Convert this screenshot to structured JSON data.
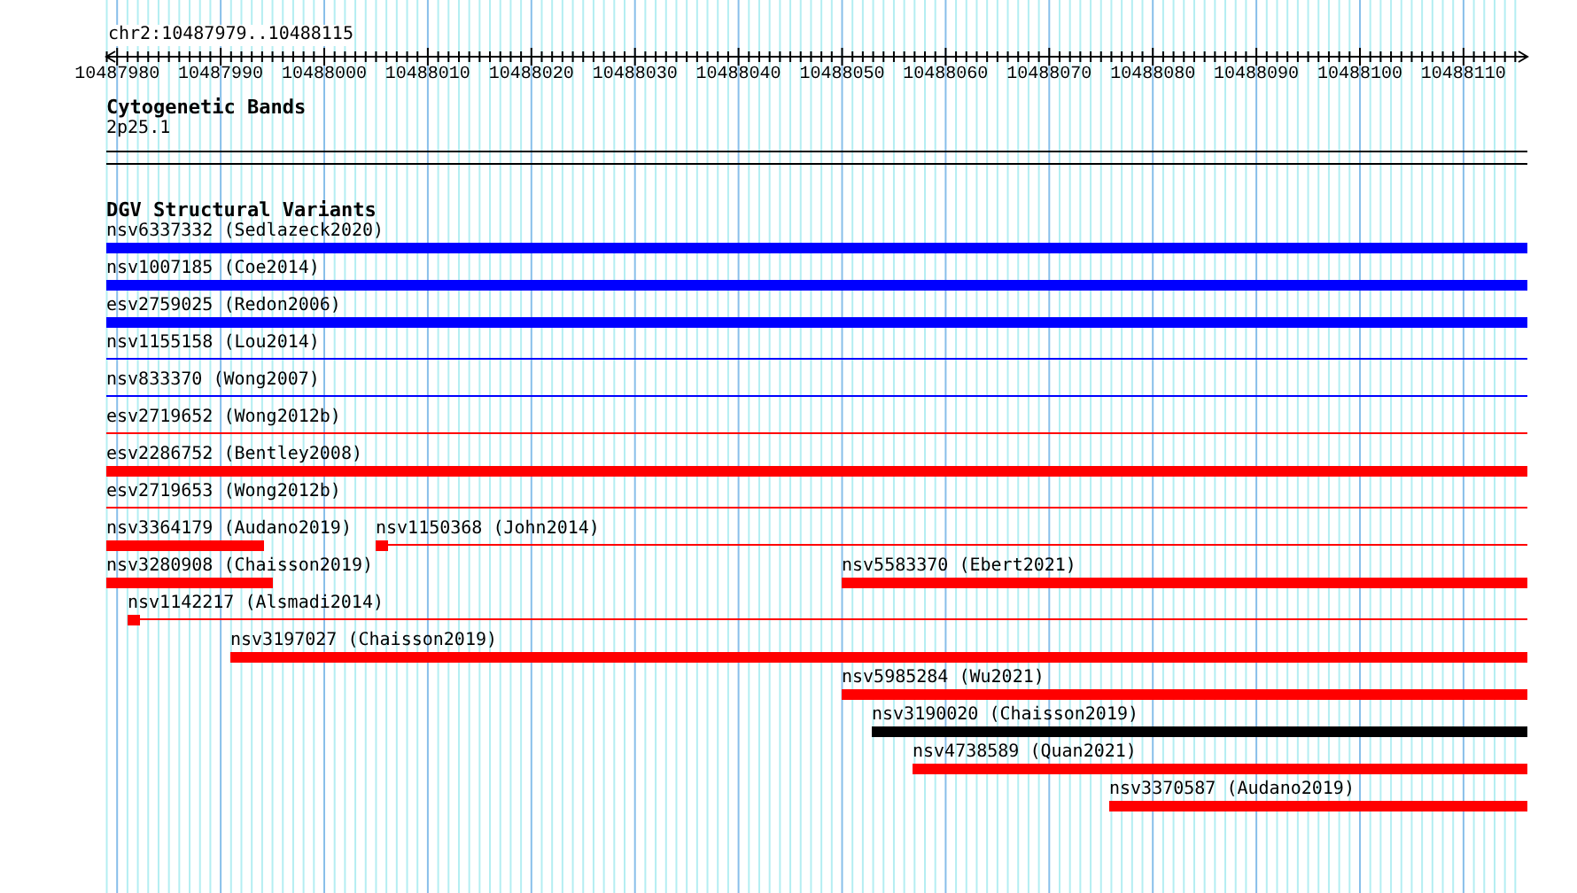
{
  "ruler": {
    "title": "chr2:10487979..10488115",
    "ticks": [
      "10487980",
      "10487990",
      "10488000",
      "10488010",
      "10488020",
      "10488030",
      "10488040",
      "10488050",
      "10488060",
      "10488070",
      "10488080",
      "10488090",
      "10488100",
      "10488110"
    ]
  },
  "cytoband_track": {
    "title": "Cytogenetic Bands",
    "band": "2p25.1"
  },
  "variant_track": {
    "title": "DGV Structural Variants",
    "rows": [
      {
        "features": [
          {
            "label": "nsv6337332 (Sedlazeck2020)",
            "kind": "bar",
            "color": "#0000ff"
          }
        ]
      },
      {
        "features": [
          {
            "label": "nsv1007185 (Coe2014)",
            "kind": "bar",
            "color": "#0000ff"
          }
        ]
      },
      {
        "features": [
          {
            "label": "esv2759025 (Redon2006)",
            "kind": "bar",
            "color": "#0000ff"
          }
        ]
      },
      {
        "features": [
          {
            "label": "nsv1155158 (Lou2014)",
            "kind": "line",
            "color": "#0000ff"
          }
        ]
      },
      {
        "features": [
          {
            "label": "nsv833370 (Wong2007)",
            "kind": "line",
            "color": "#0000ff"
          }
        ]
      },
      {
        "features": [
          {
            "label": "esv2719652 (Wong2012b)",
            "kind": "line",
            "color": "#ff0000"
          }
        ]
      },
      {
        "features": [
          {
            "label": "esv2286752 (Bentley2008)",
            "kind": "bar",
            "color": "#ff0000"
          }
        ]
      },
      {
        "features": [
          {
            "label": "esv2719653 (Wong2012b)",
            "kind": "line",
            "color": "#ff0000"
          }
        ]
      },
      {
        "features": [
          {
            "label": "nsv3364179 (Audano2019)",
            "kind": "bar",
            "color": "#ff0000"
          },
          {
            "label": "nsv1150368 (John2014)",
            "kind": "box-line",
            "color": "#ff0000"
          }
        ]
      },
      {
        "features": [
          {
            "label": "nsv3280908 (Chaisson2019)",
            "kind": "bar",
            "color": "#ff0000"
          },
          {
            "label": "nsv5583370 (Ebert2021)",
            "kind": "bar",
            "color": "#ff0000"
          }
        ]
      },
      {
        "features": [
          {
            "label": "nsv1142217 (Alsmadi2014)",
            "kind": "box-line",
            "color": "#ff0000"
          }
        ]
      },
      {
        "features": [
          {
            "label": "nsv3197027 (Chaisson2019)",
            "kind": "bar",
            "color": "#ff0000"
          }
        ]
      },
      {
        "features": [
          {
            "label": "nsv5985284 (Wu2021)",
            "kind": "bar",
            "color": "#ff0000"
          }
        ]
      },
      {
        "features": [
          {
            "label": "nsv3190020 (Chaisson2019)",
            "kind": "bar",
            "color": "#000000"
          }
        ]
      },
      {
        "features": [
          {
            "label": "nsv4738589 (Quan2021)",
            "kind": "bar",
            "color": "#ff0000"
          }
        ]
      },
      {
        "features": [
          {
            "label": "nsv3370587 (Audano2019)",
            "kind": "bar",
            "color": "#ff0000"
          }
        ]
      }
    ]
  }
}
